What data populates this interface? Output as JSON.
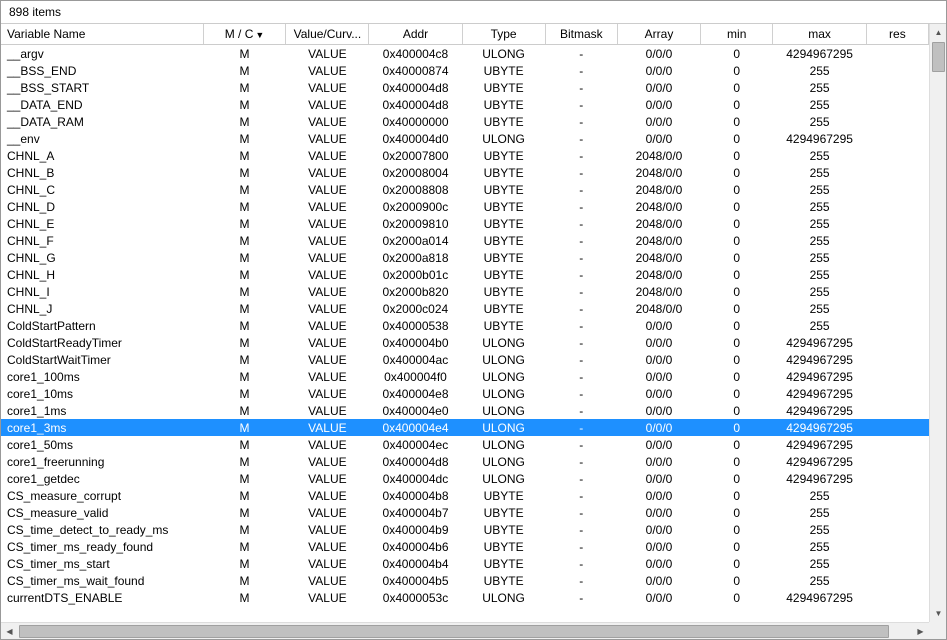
{
  "header": {
    "count_label": "898 items"
  },
  "columns": {
    "name": "Variable Name",
    "mc": "M / C",
    "val": "Value/Curv...",
    "addr": "Addr",
    "type": "Type",
    "bit": "Bitmask",
    "arr": "Array",
    "min": "min",
    "max": "max",
    "res": "res"
  },
  "sort_indicator": "▼",
  "rows": [
    {
      "name": "__argv",
      "mc": "M",
      "val": "VALUE",
      "addr": "0x400004c8",
      "type": "ULONG",
      "bit": "-",
      "arr": "0/0/0",
      "min": "0",
      "max": "4294967295",
      "sel": false
    },
    {
      "name": "__BSS_END",
      "mc": "M",
      "val": "VALUE",
      "addr": "0x40000874",
      "type": "UBYTE",
      "bit": "-",
      "arr": "0/0/0",
      "min": "0",
      "max": "255",
      "sel": false
    },
    {
      "name": "__BSS_START",
      "mc": "M",
      "val": "VALUE",
      "addr": "0x400004d8",
      "type": "UBYTE",
      "bit": "-",
      "arr": "0/0/0",
      "min": "0",
      "max": "255",
      "sel": false
    },
    {
      "name": "__DATA_END",
      "mc": "M",
      "val": "VALUE",
      "addr": "0x400004d8",
      "type": "UBYTE",
      "bit": "-",
      "arr": "0/0/0",
      "min": "0",
      "max": "255",
      "sel": false
    },
    {
      "name": "__DATA_RAM",
      "mc": "M",
      "val": "VALUE",
      "addr": "0x40000000",
      "type": "UBYTE",
      "bit": "-",
      "arr": "0/0/0",
      "min": "0",
      "max": "255",
      "sel": false
    },
    {
      "name": "__env",
      "mc": "M",
      "val": "VALUE",
      "addr": "0x400004d0",
      "type": "ULONG",
      "bit": "-",
      "arr": "0/0/0",
      "min": "0",
      "max": "4294967295",
      "sel": false
    },
    {
      "name": "CHNL_A",
      "mc": "M",
      "val": "VALUE",
      "addr": "0x20007800",
      "type": "UBYTE",
      "bit": "-",
      "arr": "2048/0/0",
      "min": "0",
      "max": "255",
      "sel": false
    },
    {
      "name": "CHNL_B",
      "mc": "M",
      "val": "VALUE",
      "addr": "0x20008004",
      "type": "UBYTE",
      "bit": "-",
      "arr": "2048/0/0",
      "min": "0",
      "max": "255",
      "sel": false
    },
    {
      "name": "CHNL_C",
      "mc": "M",
      "val": "VALUE",
      "addr": "0x20008808",
      "type": "UBYTE",
      "bit": "-",
      "arr": "2048/0/0",
      "min": "0",
      "max": "255",
      "sel": false
    },
    {
      "name": "CHNL_D",
      "mc": "M",
      "val": "VALUE",
      "addr": "0x2000900c",
      "type": "UBYTE",
      "bit": "-",
      "arr": "2048/0/0",
      "min": "0",
      "max": "255",
      "sel": false
    },
    {
      "name": "CHNL_E",
      "mc": "M",
      "val": "VALUE",
      "addr": "0x20009810",
      "type": "UBYTE",
      "bit": "-",
      "arr": "2048/0/0",
      "min": "0",
      "max": "255",
      "sel": false
    },
    {
      "name": "CHNL_F",
      "mc": "M",
      "val": "VALUE",
      "addr": "0x2000a014",
      "type": "UBYTE",
      "bit": "-",
      "arr": "2048/0/0",
      "min": "0",
      "max": "255",
      "sel": false
    },
    {
      "name": "CHNL_G",
      "mc": "M",
      "val": "VALUE",
      "addr": "0x2000a818",
      "type": "UBYTE",
      "bit": "-",
      "arr": "2048/0/0",
      "min": "0",
      "max": "255",
      "sel": false
    },
    {
      "name": "CHNL_H",
      "mc": "M",
      "val": "VALUE",
      "addr": "0x2000b01c",
      "type": "UBYTE",
      "bit": "-",
      "arr": "2048/0/0",
      "min": "0",
      "max": "255",
      "sel": false
    },
    {
      "name": "CHNL_I",
      "mc": "M",
      "val": "VALUE",
      "addr": "0x2000b820",
      "type": "UBYTE",
      "bit": "-",
      "arr": "2048/0/0",
      "min": "0",
      "max": "255",
      "sel": false
    },
    {
      "name": "CHNL_J",
      "mc": "M",
      "val": "VALUE",
      "addr": "0x2000c024",
      "type": "UBYTE",
      "bit": "-",
      "arr": "2048/0/0",
      "min": "0",
      "max": "255",
      "sel": false
    },
    {
      "name": "ColdStartPattern",
      "mc": "M",
      "val": "VALUE",
      "addr": "0x40000538",
      "type": "UBYTE",
      "bit": "-",
      "arr": "0/0/0",
      "min": "0",
      "max": "255",
      "sel": false
    },
    {
      "name": "ColdStartReadyTimer",
      "mc": "M",
      "val": "VALUE",
      "addr": "0x400004b0",
      "type": "ULONG",
      "bit": "-",
      "arr": "0/0/0",
      "min": "0",
      "max": "4294967295",
      "sel": false
    },
    {
      "name": "ColdStartWaitTimer",
      "mc": "M",
      "val": "VALUE",
      "addr": "0x400004ac",
      "type": "ULONG",
      "bit": "-",
      "arr": "0/0/0",
      "min": "0",
      "max": "4294967295",
      "sel": false
    },
    {
      "name": "core1_100ms",
      "mc": "M",
      "val": "VALUE",
      "addr": "0x400004f0",
      "type": "ULONG",
      "bit": "-",
      "arr": "0/0/0",
      "min": "0",
      "max": "4294967295",
      "sel": false
    },
    {
      "name": "core1_10ms",
      "mc": "M",
      "val": "VALUE",
      "addr": "0x400004e8",
      "type": "ULONG",
      "bit": "-",
      "arr": "0/0/0",
      "min": "0",
      "max": "4294967295",
      "sel": false
    },
    {
      "name": "core1_1ms",
      "mc": "M",
      "val": "VALUE",
      "addr": "0x400004e0",
      "type": "ULONG",
      "bit": "-",
      "arr": "0/0/0",
      "min": "0",
      "max": "4294967295",
      "sel": false
    },
    {
      "name": "core1_3ms",
      "mc": "M",
      "val": "VALUE",
      "addr": "0x400004e4",
      "type": "ULONG",
      "bit": "-",
      "arr": "0/0/0",
      "min": "0",
      "max": "4294967295",
      "sel": true
    },
    {
      "name": "core1_50ms",
      "mc": "M",
      "val": "VALUE",
      "addr": "0x400004ec",
      "type": "ULONG",
      "bit": "-",
      "arr": "0/0/0",
      "min": "0",
      "max": "4294967295",
      "sel": false
    },
    {
      "name": "core1_freerunning",
      "mc": "M",
      "val": "VALUE",
      "addr": "0x400004d8",
      "type": "ULONG",
      "bit": "-",
      "arr": "0/0/0",
      "min": "0",
      "max": "4294967295",
      "sel": false
    },
    {
      "name": "core1_getdec",
      "mc": "M",
      "val": "VALUE",
      "addr": "0x400004dc",
      "type": "ULONG",
      "bit": "-",
      "arr": "0/0/0",
      "min": "0",
      "max": "4294967295",
      "sel": false
    },
    {
      "name": "CS_measure_corrupt",
      "mc": "M",
      "val": "VALUE",
      "addr": "0x400004b8",
      "type": "UBYTE",
      "bit": "-",
      "arr": "0/0/0",
      "min": "0",
      "max": "255",
      "sel": false
    },
    {
      "name": "CS_measure_valid",
      "mc": "M",
      "val": "VALUE",
      "addr": "0x400004b7",
      "type": "UBYTE",
      "bit": "-",
      "arr": "0/0/0",
      "min": "0",
      "max": "255",
      "sel": false
    },
    {
      "name": "CS_time_detect_to_ready_ms",
      "mc": "M",
      "val": "VALUE",
      "addr": "0x400004b9",
      "type": "UBYTE",
      "bit": "-",
      "arr": "0/0/0",
      "min": "0",
      "max": "255",
      "sel": false
    },
    {
      "name": "CS_timer_ms_ready_found",
      "mc": "M",
      "val": "VALUE",
      "addr": "0x400004b6",
      "type": "UBYTE",
      "bit": "-",
      "arr": "0/0/0",
      "min": "0",
      "max": "255",
      "sel": false
    },
    {
      "name": "CS_timer_ms_start",
      "mc": "M",
      "val": "VALUE",
      "addr": "0x400004b4",
      "type": "UBYTE",
      "bit": "-",
      "arr": "0/0/0",
      "min": "0",
      "max": "255",
      "sel": false
    },
    {
      "name": "CS_timer_ms_wait_found",
      "mc": "M",
      "val": "VALUE",
      "addr": "0x400004b5",
      "type": "UBYTE",
      "bit": "-",
      "arr": "0/0/0",
      "min": "0",
      "max": "255",
      "sel": false
    },
    {
      "name": "currentDTS_ENABLE",
      "mc": "M",
      "val": "VALUE",
      "addr": "0x4000053c",
      "type": "ULONG",
      "bit": "-",
      "arr": "0/0/0",
      "min": "0",
      "max": "4294967295",
      "sel": false
    }
  ]
}
